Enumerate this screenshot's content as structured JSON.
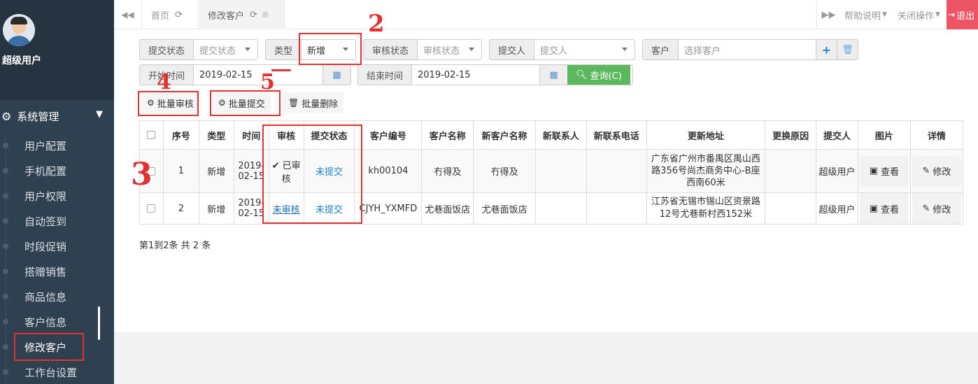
{
  "sidebar": {
    "username": "超级用户",
    "menu_title": "系统管理",
    "items": [
      {
        "label": "用户配置"
      },
      {
        "label": "手机配置"
      },
      {
        "label": "用户权限"
      },
      {
        "label": "自动签到"
      },
      {
        "label": "时段促销"
      },
      {
        "label": "搭赠销售"
      },
      {
        "label": "商品信息"
      },
      {
        "label": "客户信息"
      },
      {
        "label": "修改客户"
      },
      {
        "label": "工作台设置"
      }
    ],
    "active_index": 8
  },
  "topbar": {
    "tabs": [
      {
        "label": "首页"
      },
      {
        "label": "修改客户"
      }
    ],
    "help_label": "帮助说明",
    "close_ops_label": "关闭操作",
    "logout_label": "退出"
  },
  "filters": {
    "submit_status_label": "提交状态",
    "submit_status_placeholder": "提交状态",
    "type_label": "类型",
    "type_value": "新增",
    "audit_status_label": "审核状态",
    "audit_status_placeholder": "审核状态",
    "submitter_label": "提交人",
    "submitter_placeholder": "提交人",
    "customer_label": "客户",
    "customer_placeholder": "选择客户",
    "start_time_label": "开始时间",
    "start_time_value": "2019-02-15",
    "end_time_label": "结束时间",
    "end_time_value": "2019-02-15",
    "query_label": "查询(C)"
  },
  "actions": {
    "batch_audit": "批量审核",
    "batch_submit": "批量提交",
    "batch_delete": "批量删除"
  },
  "table": {
    "headers": [
      "序号",
      "类型",
      "时间",
      "审核",
      "提交状态",
      "客户编号",
      "客户名称",
      "新客户名称",
      "新联系人",
      "新联系电话",
      "更新地址",
      "更换原因",
      "提交人",
      "图片",
      "详情"
    ],
    "rows": [
      {
        "index": "1",
        "type": "新增",
        "time_line1": "2019-",
        "time_line2": "02-15",
        "audit": "已审核",
        "submit_status": "未提交",
        "customer_code": "kh00104",
        "customer_name": "冇得及",
        "new_customer_name": "冇得及",
        "new_contact": "",
        "new_phone": "",
        "address": "广东省广州市番禺区禺山西路356号尚杰商务中心-B座西南60米",
        "reason": "",
        "submitter": "超级用户",
        "view_label": "查看",
        "edit_label": "修改"
      },
      {
        "index": "2",
        "type": "新增",
        "time_line1": "2019-",
        "time_line2": "02-15",
        "audit": "未审核",
        "submit_status": "未提交",
        "customer_code": "CJYH_YXMFD",
        "customer_name": "尤巷面饭店",
        "new_customer_name": "尤巷面饭店",
        "new_contact": "",
        "new_phone": "",
        "address": "江苏省无锡市锡山区资景路12号尤巷新村西152米",
        "reason": "",
        "submitter": "超级用户",
        "view_label": "查看",
        "edit_label": "修改"
      }
    ]
  },
  "pager": {
    "text": "第1到2条 共 2 条"
  },
  "annotations": {
    "mark_2": "2",
    "mark_3": "3",
    "mark_4": "4",
    "mark_5": "5"
  },
  "colors": {
    "sidebar_bg": "#2f4050",
    "annotation_red": "#e53030",
    "query_green": "#5cb85c",
    "logout_red": "#ed5565",
    "link_blue": "#1c84c6"
  }
}
